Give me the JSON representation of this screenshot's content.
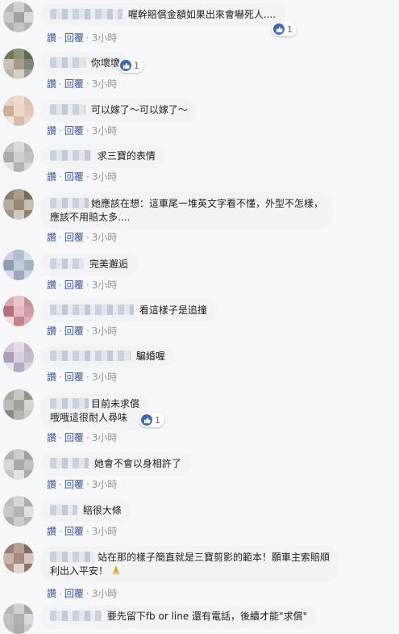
{
  "actions": {
    "like": "讚",
    "reply": "回覆",
    "time": "3小時",
    "sep": "·"
  },
  "comments": [
    {
      "text": "喔幹賠償金額如果出來會嚇死人....",
      "reaction_count": "1"
    },
    {
      "text": "你壞壞",
      "reaction_count": "1"
    },
    {
      "text": "可以嫁了～可以嫁了～"
    },
    {
      "text": "求三寶的表情"
    },
    {
      "line1": "她應該在想：這車尾一堆英文字看不懂，外型不怎樣，",
      "line2": "應該不用賠太多...."
    },
    {
      "text": "完美邂逅"
    },
    {
      "text": "看這樣子是追撞"
    },
    {
      "text": "騙婚喔"
    },
    {
      "line1": "目前未求償",
      "line2": "哦哦這很耐人尋味",
      "reaction_count": "1"
    },
    {
      "text": "她會不會以身相許了"
    },
    {
      "text": "賠很大條"
    },
    {
      "line1": "站在那的樣子簡直就是三寶剪影的範本！願車主索賠順",
      "line2": "利出入平安！"
    },
    {
      "text": "要先留下fb or line 還有電話，後續才能\"求償\""
    }
  ],
  "colors": {
    "link": "#385898",
    "bubble": "#f2f3f5",
    "like": "#4267b2"
  }
}
